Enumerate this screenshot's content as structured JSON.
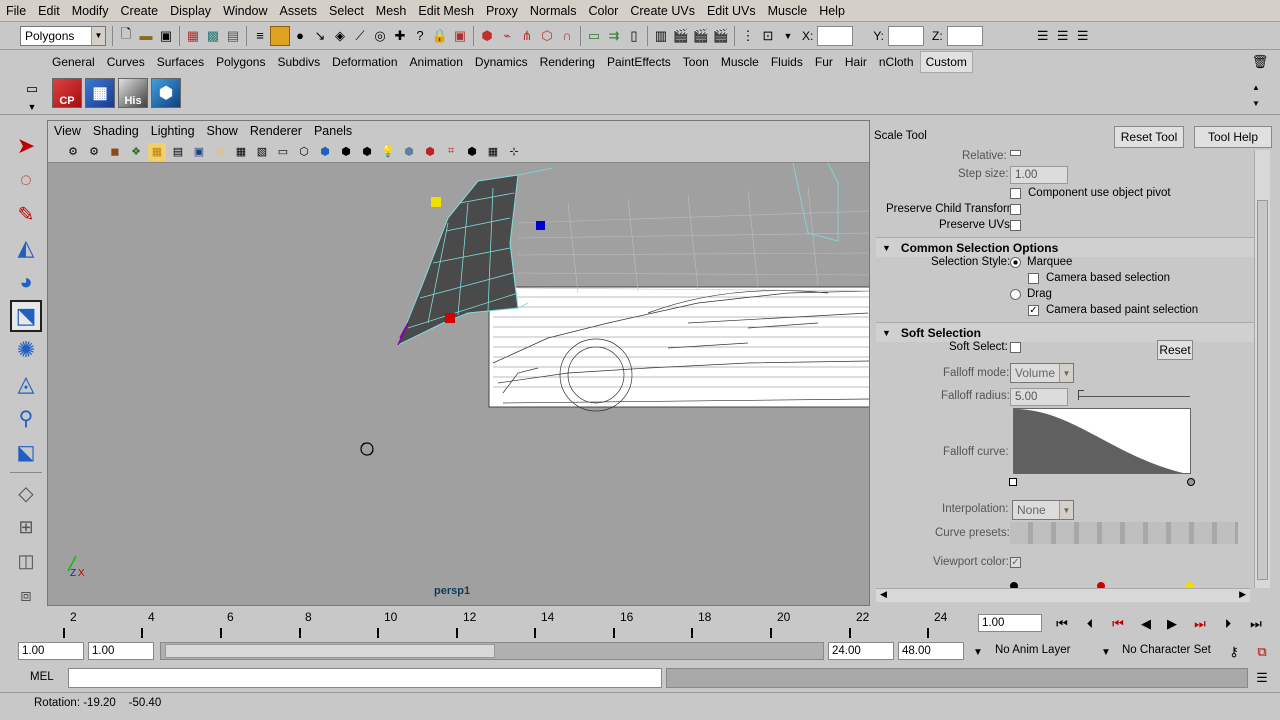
{
  "menubar": [
    "File",
    "Edit",
    "Modify",
    "Create",
    "Display",
    "Window",
    "Assets",
    "Select",
    "Mesh",
    "Edit Mesh",
    "Proxy",
    "Normals",
    "Color",
    "Create UVs",
    "Edit UVs",
    "Muscle",
    "Help"
  ],
  "status": {
    "mode": "Polygons",
    "x_label": "X:",
    "y_label": "Y:",
    "z_label": "Z:"
  },
  "shelf_tabs": [
    "General",
    "Curves",
    "Surfaces",
    "Polygons",
    "Subdivs",
    "Deformation",
    "Animation",
    "Dynamics",
    "Rendering",
    "PaintEffects",
    "Toon",
    "Muscle",
    "Fluids",
    "Fur",
    "Hair",
    "nCloth",
    "Custom"
  ],
  "shelf_active": "Custom",
  "shelf_buttons": [
    "CP",
    "",
    "His",
    ""
  ],
  "viewport": {
    "menu": [
      "View",
      "Shading",
      "Lighting",
      "Show",
      "Renderer",
      "Panels"
    ],
    "camera": "persp1",
    "axis_x": "X",
    "axis_z": "Z"
  },
  "panel": {
    "title": "Scale Tool",
    "reset_tool": "Reset Tool",
    "tool_help": "Tool Help",
    "relative": "Relative:",
    "step_size": "Step size:",
    "step_value": "1.00",
    "component_pivot": "Component use object pivot",
    "preserve_child": "Preserve Child Transform",
    "preserve_uvs": "Preserve UVs",
    "common_sel": "Common Selection Options",
    "sel_style": "Selection Style:",
    "marquee": "Marquee",
    "camera_sel": "Camera based selection",
    "drag": "Drag",
    "camera_paint": "Camera based paint selection",
    "soft_sel": "Soft Selection",
    "soft_select": "Soft Select:",
    "reset": "Reset",
    "falloff_mode": "Falloff mode:",
    "falloff_mode_val": "Volume",
    "falloff_radius": "Falloff radius:",
    "falloff_radius_val": "5.00",
    "falloff_curve": "Falloff curve:",
    "interpolation": "Interpolation:",
    "interp_val": "None",
    "curve_presets": "Curve presets:",
    "viewport_color": "Viewport color:"
  },
  "timeline": {
    "ticks": [
      "2",
      "4",
      "6",
      "8",
      "10",
      "12",
      "14",
      "16",
      "18",
      "20",
      "22",
      "24"
    ],
    "current": "1.00"
  },
  "range": {
    "start": "1.00",
    "start2": "1.00",
    "end": "24.00",
    "end2": "48.00",
    "anim_layer": "No Anim Layer",
    "char_set": "No Character Set"
  },
  "cmd": {
    "label": "MEL"
  },
  "help": {
    "text": "Rotation: -19.20    -50.40"
  }
}
